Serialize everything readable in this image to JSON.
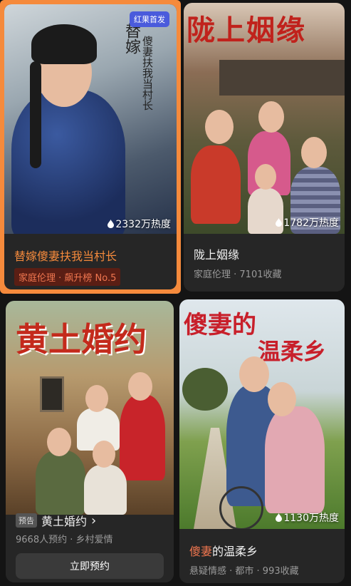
{
  "cards": [
    {
      "title": "替嫁傻妻扶我当村长",
      "badge": "红果首发",
      "heat": "2332万热度",
      "rank_label": "家庭伦理 · 飙升榜 No.5",
      "poster_text_a": "替嫁",
      "poster_text_b": "傻妻扶我当村长"
    },
    {
      "title": "陇上姻缘",
      "heat": "1782万热度",
      "meta": "家庭伦理 · 7101收藏",
      "poster_title": "陇上姻缘"
    },
    {
      "title": "黄土婚约",
      "pre_tag": "预告",
      "arrow": "›",
      "meta": "9668人预约 · 乡村爱情",
      "button": "立即预约",
      "poster_title": "黄土婚约"
    },
    {
      "title_highlight": "傻妻",
      "title_rest": "的温柔乡",
      "heat": "1130万热度",
      "meta": "悬疑情感 · 都市 · 993收藏",
      "poster_title_a": "傻妻的",
      "poster_title_b": "温柔乡"
    }
  ],
  "colors": {
    "accent": "#f58a3c",
    "highlight": "#f0764f",
    "badge": "#4a5bdc"
  },
  "icons": {
    "heat": "flame-drop-icon",
    "arrow": "chevron-right-icon"
  }
}
